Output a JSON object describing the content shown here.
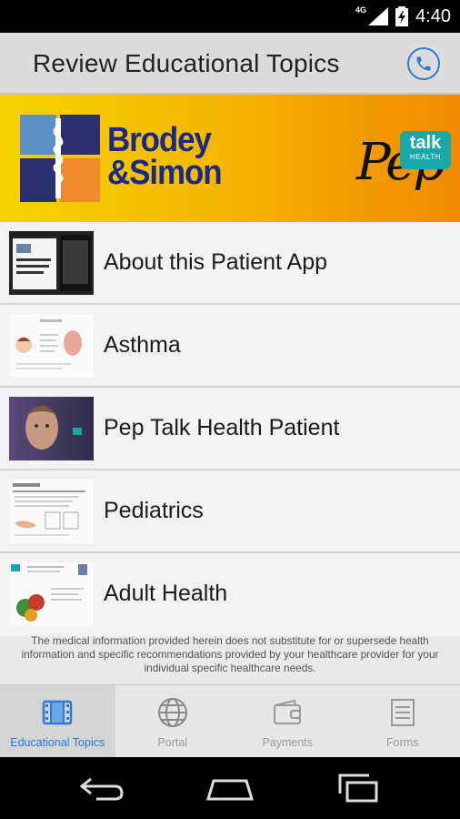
{
  "status_bar": {
    "network": "4G",
    "time": "4:40"
  },
  "app_bar": {
    "title": "Review Educational Topics",
    "call_icon": "phone-icon"
  },
  "banner": {
    "brand_line1": "Brodey",
    "brand_line2": "&Simon",
    "pep_text": "Pep",
    "talk_text": "talk",
    "health_text": "HEALTH"
  },
  "topics": [
    {
      "label": "About this Patient App"
    },
    {
      "label": "Asthma"
    },
    {
      "label": "Pep Talk Health Patient"
    },
    {
      "label": "Pediatrics"
    },
    {
      "label": "Adult Health"
    }
  ],
  "disclaimer": "The medical information provided herein does not substitute for or supersede health information and specific recommendations provided by your healthcare provider for your individual specific healthcare needs.",
  "bottom_nav": [
    {
      "label": "Educational Topics",
      "icon": "film-icon",
      "active": true
    },
    {
      "label": "Portal",
      "icon": "globe-icon",
      "active": false
    },
    {
      "label": "Payments",
      "icon": "wallet-icon",
      "active": false
    },
    {
      "label": "Forms",
      "icon": "document-icon",
      "active": false
    }
  ],
  "colors": {
    "accent": "#2d78d9",
    "brand_blue": "#1a2a86",
    "banner_start": "#f6d200",
    "banner_end": "#f08a00"
  }
}
